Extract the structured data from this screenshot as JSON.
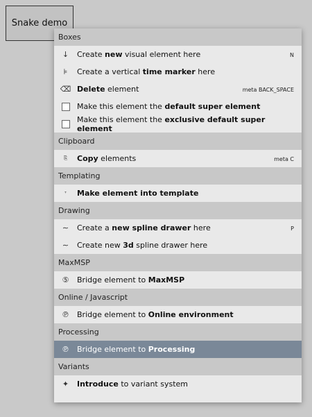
{
  "button": {
    "label": "Snake demo"
  },
  "menu": {
    "sections": [
      {
        "title": "Boxes",
        "items": [
          {
            "icon": "down-arrow-icon",
            "glyph": "↓",
            "pre": "Create ",
            "bold": "new",
            "post": " visual element here",
            "shortcut": "N"
          },
          {
            "icon": "time-marker-icon",
            "glyph": "⊧",
            "pre": "Create a vertical ",
            "bold": "time marker",
            "post": " here",
            "shortcut": ""
          },
          {
            "icon": "backspace-delete-icon",
            "glyph": "⌫",
            "pre": "",
            "bold": "Delete",
            "post": " element",
            "shortcut": "meta BACK_SPACE"
          },
          {
            "icon": "checkbox-icon",
            "glyph": "",
            "pre": "Make this element the ",
            "bold": "default super element",
            "post": "",
            "shortcut": ""
          },
          {
            "icon": "checkbox-icon",
            "glyph": "",
            "pre": "Make this element the ",
            "bold": "exclusive default super element",
            "post": "",
            "shortcut": ""
          }
        ]
      },
      {
        "title": "Clipboard",
        "items": [
          {
            "icon": "copy-icon",
            "glyph": "⎘",
            "pre": "",
            "bold": "Copy",
            "post": " elements",
            "shortcut": "meta C"
          }
        ]
      },
      {
        "title": "Templating",
        "items": [
          {
            "icon": "template-icon",
            "glyph": "ᵀ",
            "pre": "",
            "bold": "Make element into template",
            "post": "",
            "shortcut": ""
          }
        ]
      },
      {
        "title": "Drawing",
        "items": [
          {
            "icon": "spline-icon",
            "glyph": "∼",
            "pre": "Create a ",
            "bold": "new spline drawer",
            "post": " here",
            "shortcut": "P"
          },
          {
            "icon": "spline-3d-icon",
            "glyph": "∼",
            "pre": "Create new ",
            "bold": "3d",
            "post": " spline drawer here",
            "shortcut": ""
          }
        ]
      },
      {
        "title": "MaxMSP",
        "items": [
          {
            "icon": "maxmsp-icon",
            "glyph": "⑤",
            "pre": "Bridge element to ",
            "bold": "MaxMSP",
            "post": "",
            "shortcut": ""
          }
        ]
      },
      {
        "title": "Online / Javascript",
        "items": [
          {
            "icon": "online-icon",
            "glyph": "℗",
            "pre": "Bridge element to ",
            "bold": "Online environment",
            "post": "",
            "shortcut": ""
          }
        ]
      },
      {
        "title": "Processing",
        "items": [
          {
            "icon": "processing-icon",
            "glyph": "℗",
            "pre": "Bridge element to ",
            "bold": "Processing",
            "post": "",
            "shortcut": "",
            "selected": true
          }
        ]
      },
      {
        "title": "Variants",
        "items": [
          {
            "icon": "star-icon",
            "glyph": "✦",
            "pre": "",
            "bold": "Introduce",
            "post": " to variant system",
            "shortcut": ""
          }
        ]
      }
    ]
  }
}
